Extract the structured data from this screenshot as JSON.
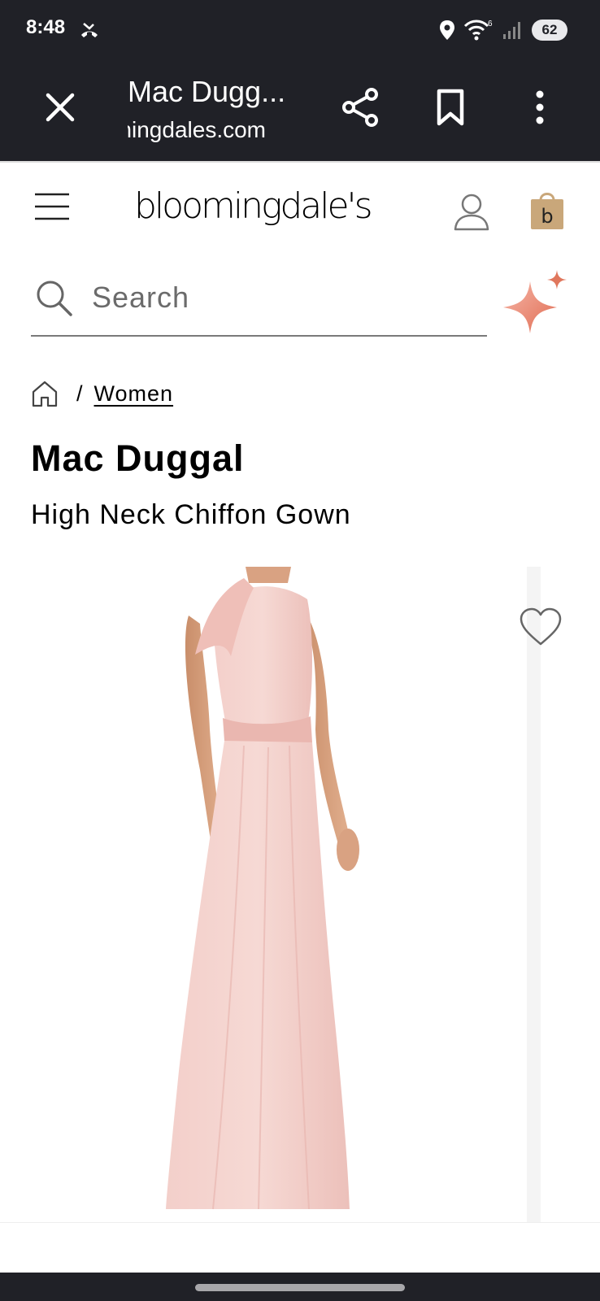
{
  "status_bar": {
    "time": "8:48",
    "battery": "62",
    "wifi_label": "6"
  },
  "browser": {
    "page_title": "Mac Dugg...",
    "url": "bloomingdales.com"
  },
  "site": {
    "logo_text": "bloomingdale's"
  },
  "search": {
    "placeholder": "Search"
  },
  "breadcrumb": {
    "separator": "/",
    "items": [
      "Women"
    ]
  },
  "product": {
    "brand": "Mac Duggal",
    "name": "High Neck Chiffon Gown",
    "image_alt": "Model wearing pink high neck chiffon gown"
  },
  "colors": {
    "chrome_bg": "#202127",
    "accent_sparkle": "#e8826b",
    "bag_tan": "#c9a77a",
    "gown_pink": "#f1c8c3"
  }
}
